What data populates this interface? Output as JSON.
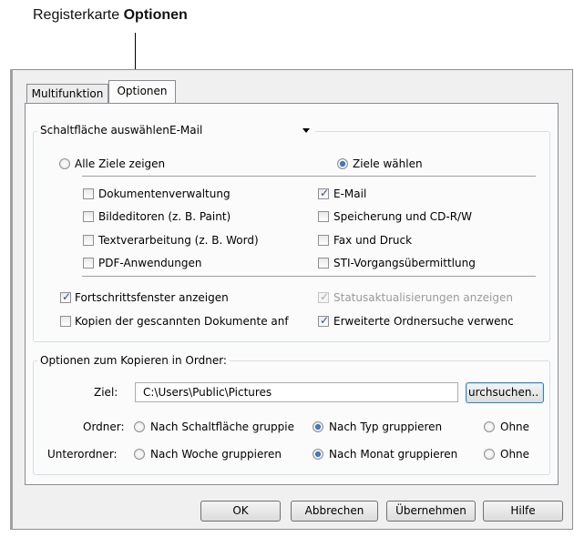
{
  "callout": {
    "prefix": "Registerkarte ",
    "bold": "Optionen"
  },
  "tabs": [
    {
      "label": "Multifunktion",
      "active": false
    },
    {
      "label": "Optionen",
      "active": true
    }
  ],
  "button_select": {
    "label": "Schaltfläche auswählen",
    "value": "E-Mail"
  },
  "targets": {
    "all_label": "Alle Ziele zeigen",
    "all_checked": false,
    "choose_label": "Ziele wählen",
    "choose_checked": true
  },
  "destinations_left": [
    {
      "label": "Dokumentenverwaltung",
      "checked": false
    },
    {
      "label": "Bildeditoren (z. B. Paint)",
      "checked": false
    },
    {
      "label": "Textverarbeitung (z. B. Word)",
      "checked": false
    },
    {
      "label": "PDF-Anwendungen",
      "checked": false
    }
  ],
  "destinations_right": [
    {
      "label": "E-Mail",
      "checked": true
    },
    {
      "label": "Speicherung und CD-R/W",
      "checked": false
    },
    {
      "label": "Fax und Druck",
      "checked": false
    },
    {
      "label": "STI-Vorgangsübermittlung",
      "checked": false
    }
  ],
  "options": {
    "progress": {
      "label": "Fortschrittsfenster anzeigen",
      "checked": true
    },
    "status": {
      "label": "Statusaktualisierungen anzeigen",
      "checked": true,
      "disabled": true
    },
    "copies": {
      "label": "Kopien der gescannten Dokumente anf",
      "checked": false
    },
    "extended": {
      "label": "Erweiterte Ordnersuche verwenc",
      "checked": true
    }
  },
  "copy_group": {
    "legend": "Optionen zum Kopieren in Ordner:",
    "target_label": "Ziel:",
    "target_value": "C:\\Users\\Public\\Pictures",
    "browse_label": "urchsuchen..",
    "folder_label": "Ordner:",
    "folder_options": [
      "Nach Schaltfläche gruppie",
      "Nach Typ gruppieren",
      "Ohne"
    ],
    "folder_selected": 1,
    "subfolder_label": "Unterordner:",
    "subfolder_options": [
      "Nach Woche gruppieren",
      "Nach Monat gruppieren",
      "Ohne"
    ],
    "subfolder_selected": 1
  },
  "footer": {
    "ok": "OK",
    "cancel": "Abbrechen",
    "apply": "Übernehmen",
    "help": "Hilfe"
  },
  "colors": {
    "check_accent": "#2a4f9c",
    "radio_accent": "#1a4c9e",
    "default_button_border": "#3c7fb1"
  }
}
